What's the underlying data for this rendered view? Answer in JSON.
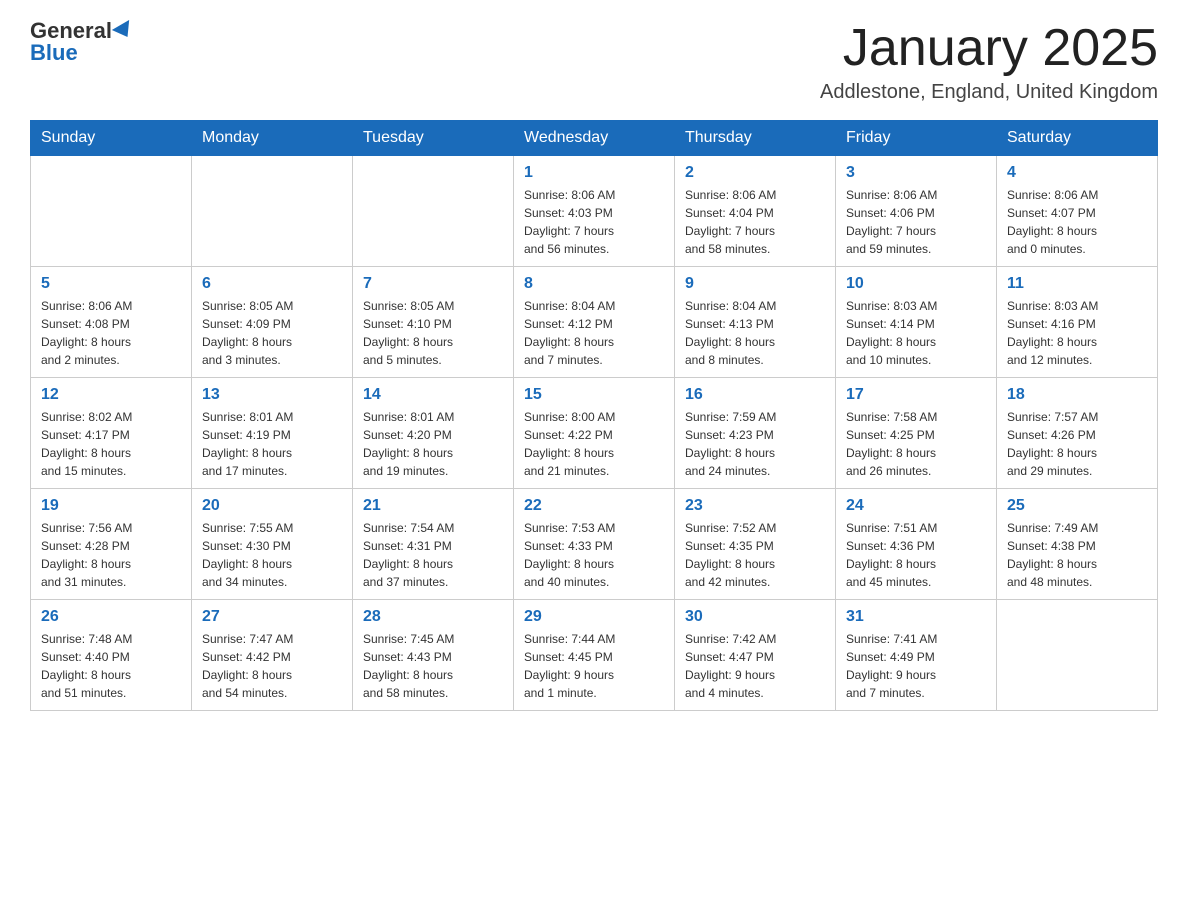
{
  "logo": {
    "general": "General",
    "blue": "Blue"
  },
  "title": "January 2025",
  "location": "Addlestone, England, United Kingdom",
  "days_of_week": [
    "Sunday",
    "Monday",
    "Tuesday",
    "Wednesday",
    "Thursday",
    "Friday",
    "Saturday"
  ],
  "weeks": [
    [
      {
        "day": "",
        "info": ""
      },
      {
        "day": "",
        "info": ""
      },
      {
        "day": "",
        "info": ""
      },
      {
        "day": "1",
        "info": "Sunrise: 8:06 AM\nSunset: 4:03 PM\nDaylight: 7 hours\nand 56 minutes."
      },
      {
        "day": "2",
        "info": "Sunrise: 8:06 AM\nSunset: 4:04 PM\nDaylight: 7 hours\nand 58 minutes."
      },
      {
        "day": "3",
        "info": "Sunrise: 8:06 AM\nSunset: 4:06 PM\nDaylight: 7 hours\nand 59 minutes."
      },
      {
        "day": "4",
        "info": "Sunrise: 8:06 AM\nSunset: 4:07 PM\nDaylight: 8 hours\nand 0 minutes."
      }
    ],
    [
      {
        "day": "5",
        "info": "Sunrise: 8:06 AM\nSunset: 4:08 PM\nDaylight: 8 hours\nand 2 minutes."
      },
      {
        "day": "6",
        "info": "Sunrise: 8:05 AM\nSunset: 4:09 PM\nDaylight: 8 hours\nand 3 minutes."
      },
      {
        "day": "7",
        "info": "Sunrise: 8:05 AM\nSunset: 4:10 PM\nDaylight: 8 hours\nand 5 minutes."
      },
      {
        "day": "8",
        "info": "Sunrise: 8:04 AM\nSunset: 4:12 PM\nDaylight: 8 hours\nand 7 minutes."
      },
      {
        "day": "9",
        "info": "Sunrise: 8:04 AM\nSunset: 4:13 PM\nDaylight: 8 hours\nand 8 minutes."
      },
      {
        "day": "10",
        "info": "Sunrise: 8:03 AM\nSunset: 4:14 PM\nDaylight: 8 hours\nand 10 minutes."
      },
      {
        "day": "11",
        "info": "Sunrise: 8:03 AM\nSunset: 4:16 PM\nDaylight: 8 hours\nand 12 minutes."
      }
    ],
    [
      {
        "day": "12",
        "info": "Sunrise: 8:02 AM\nSunset: 4:17 PM\nDaylight: 8 hours\nand 15 minutes."
      },
      {
        "day": "13",
        "info": "Sunrise: 8:01 AM\nSunset: 4:19 PM\nDaylight: 8 hours\nand 17 minutes."
      },
      {
        "day": "14",
        "info": "Sunrise: 8:01 AM\nSunset: 4:20 PM\nDaylight: 8 hours\nand 19 minutes."
      },
      {
        "day": "15",
        "info": "Sunrise: 8:00 AM\nSunset: 4:22 PM\nDaylight: 8 hours\nand 21 minutes."
      },
      {
        "day": "16",
        "info": "Sunrise: 7:59 AM\nSunset: 4:23 PM\nDaylight: 8 hours\nand 24 minutes."
      },
      {
        "day": "17",
        "info": "Sunrise: 7:58 AM\nSunset: 4:25 PM\nDaylight: 8 hours\nand 26 minutes."
      },
      {
        "day": "18",
        "info": "Sunrise: 7:57 AM\nSunset: 4:26 PM\nDaylight: 8 hours\nand 29 minutes."
      }
    ],
    [
      {
        "day": "19",
        "info": "Sunrise: 7:56 AM\nSunset: 4:28 PM\nDaylight: 8 hours\nand 31 minutes."
      },
      {
        "day": "20",
        "info": "Sunrise: 7:55 AM\nSunset: 4:30 PM\nDaylight: 8 hours\nand 34 minutes."
      },
      {
        "day": "21",
        "info": "Sunrise: 7:54 AM\nSunset: 4:31 PM\nDaylight: 8 hours\nand 37 minutes."
      },
      {
        "day": "22",
        "info": "Sunrise: 7:53 AM\nSunset: 4:33 PM\nDaylight: 8 hours\nand 40 minutes."
      },
      {
        "day": "23",
        "info": "Sunrise: 7:52 AM\nSunset: 4:35 PM\nDaylight: 8 hours\nand 42 minutes."
      },
      {
        "day": "24",
        "info": "Sunrise: 7:51 AM\nSunset: 4:36 PM\nDaylight: 8 hours\nand 45 minutes."
      },
      {
        "day": "25",
        "info": "Sunrise: 7:49 AM\nSunset: 4:38 PM\nDaylight: 8 hours\nand 48 minutes."
      }
    ],
    [
      {
        "day": "26",
        "info": "Sunrise: 7:48 AM\nSunset: 4:40 PM\nDaylight: 8 hours\nand 51 minutes."
      },
      {
        "day": "27",
        "info": "Sunrise: 7:47 AM\nSunset: 4:42 PM\nDaylight: 8 hours\nand 54 minutes."
      },
      {
        "day": "28",
        "info": "Sunrise: 7:45 AM\nSunset: 4:43 PM\nDaylight: 8 hours\nand 58 minutes."
      },
      {
        "day": "29",
        "info": "Sunrise: 7:44 AM\nSunset: 4:45 PM\nDaylight: 9 hours\nand 1 minute."
      },
      {
        "day": "30",
        "info": "Sunrise: 7:42 AM\nSunset: 4:47 PM\nDaylight: 9 hours\nand 4 minutes."
      },
      {
        "day": "31",
        "info": "Sunrise: 7:41 AM\nSunset: 4:49 PM\nDaylight: 9 hours\nand 7 minutes."
      },
      {
        "day": "",
        "info": ""
      }
    ]
  ]
}
